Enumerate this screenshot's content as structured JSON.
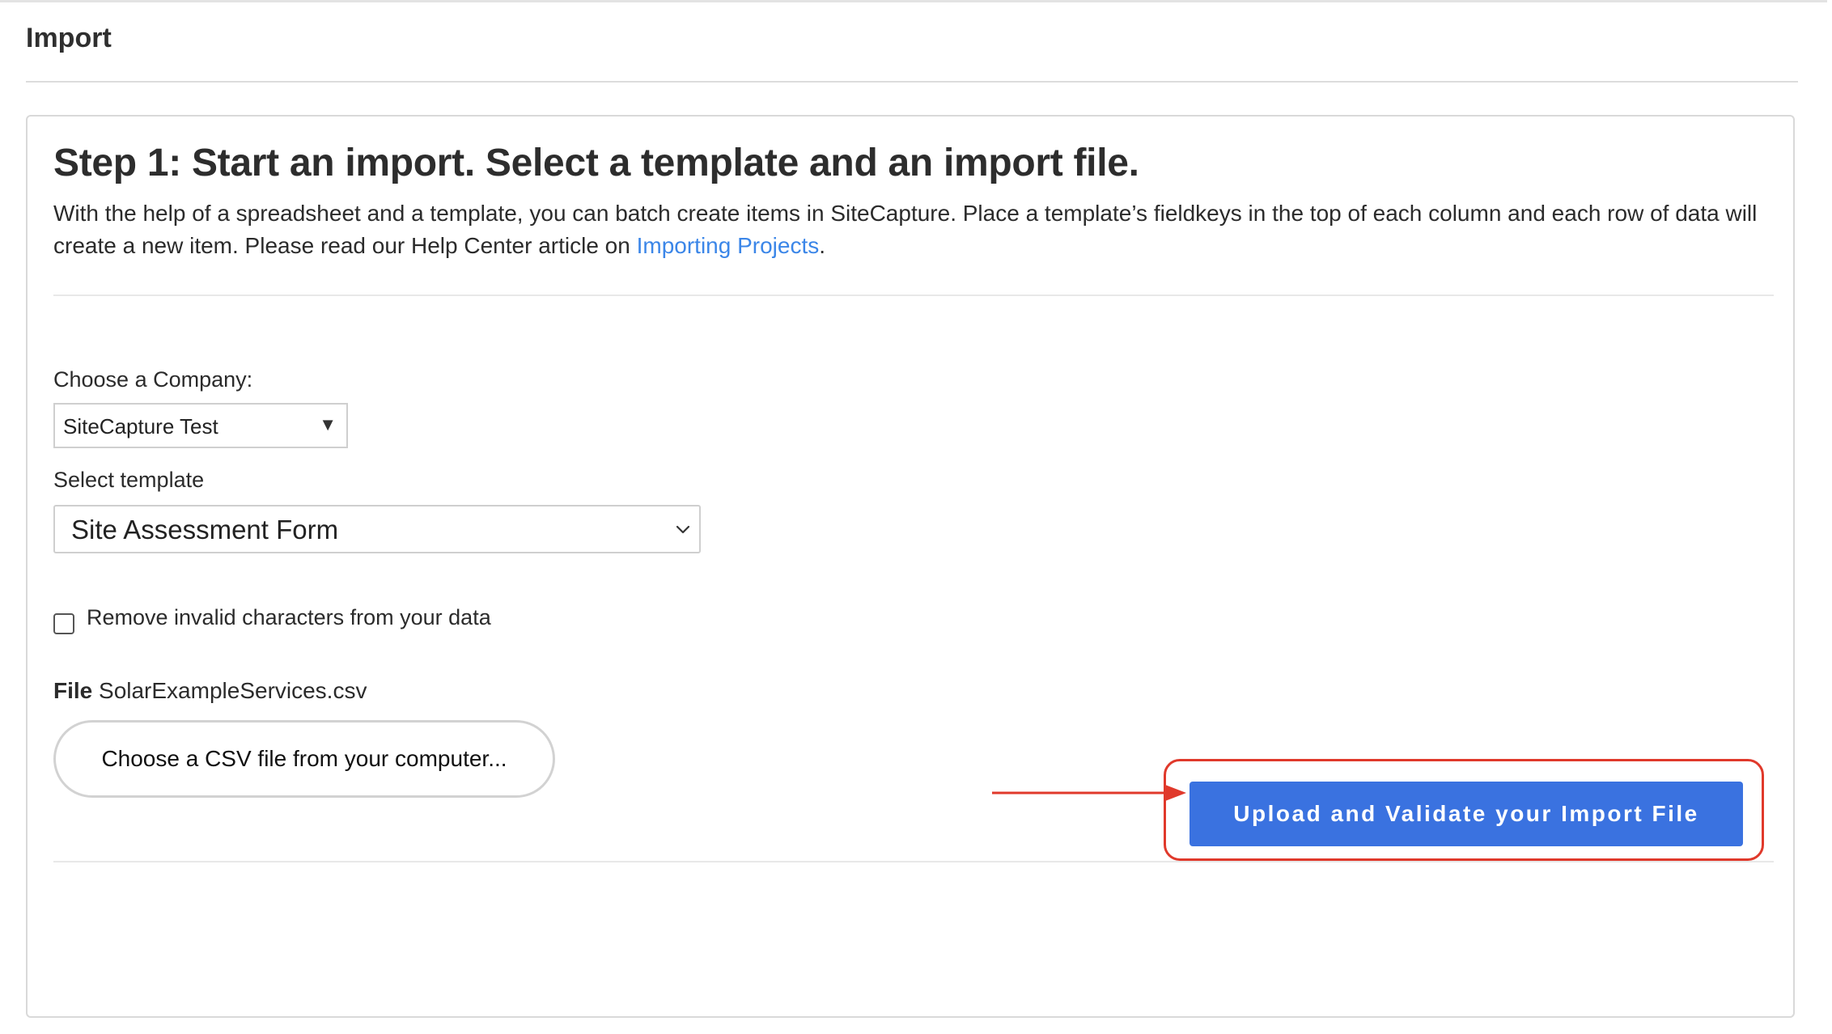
{
  "page": {
    "title": "Import"
  },
  "step1": {
    "heading": "Step 1: Start an import. Select a template and an import file.",
    "intro_text": "With the help of a spreadsheet and a template, you can batch create items in SiteCapture. Place a template’s fieldkeys in the top of each column and each row of data will create a new item. Please read our Help Center article on ",
    "intro_link": "Importing Projects",
    "intro_end": "."
  },
  "company": {
    "label": "Choose a Company:",
    "selected": "SiteCapture Test"
  },
  "template": {
    "label": "Select template",
    "selected": "Site Assessment Form"
  },
  "options": {
    "remove_invalid_label": "Remove invalid characters from your data",
    "remove_invalid_checked": false
  },
  "file": {
    "label": "File",
    "name": "SolarExampleServices.csv",
    "choose_button": "Choose a CSV file from your computer..."
  },
  "actions": {
    "upload_button": "Upload and Validate your Import File"
  },
  "colors": {
    "link": "#3b86e8",
    "primary_button": "#3a72e0",
    "annotation": "#e0392b"
  }
}
